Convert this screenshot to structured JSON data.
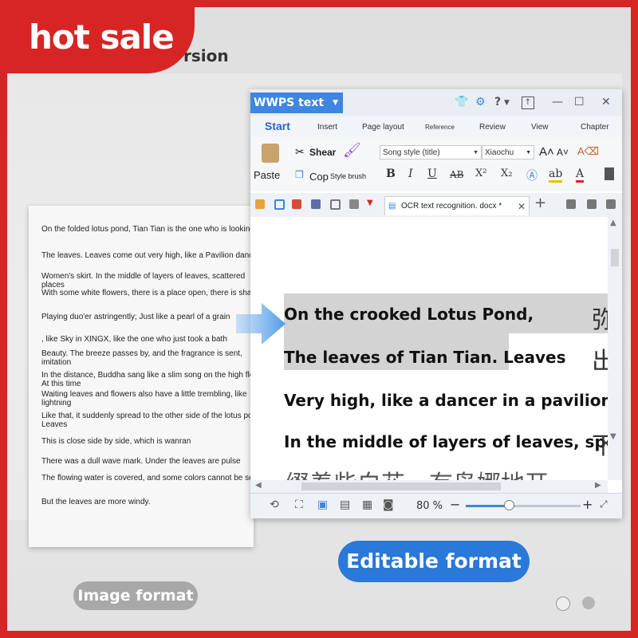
{
  "badge": {
    "text": "hot sale"
  },
  "top_title": "rsion",
  "left_paper": {
    "lines": [
      "On the folded lotus pond, Tian Tian is the one who is looking",
      "The leaves. Leaves come out very high, like a Pavilion dance",
      "Women's skirt. In the middle of layers of leaves, scattered places",
      "With some white flowers, there is a place open, there is shame",
      "Playing duo'er astringently; Just like a pearl of a grain",
      ", like Sky in XINGX, like the one who just took a bath",
      "Beauty. The breeze passes by, and the fragrance is sent, imitation",
      "In the distance, Buddha sang like a slim song on the high floor. At this time",
      "Waiting leaves and flowers also have a little trembling, like lightning",
      "Like that, it suddenly spread to the other side of the lotus pond. Leaves",
      "This is close side by side, which is wanran",
      "There was a dull wave mark. Under the leaves are pulse",
      "The flowing water is covered, and some colors cannot be seen;",
      "But the leaves are more windy."
    ]
  },
  "window": {
    "app_name": "WWPS text",
    "help": "?",
    "menu": {
      "start": "Start",
      "insert": "Insert",
      "page_layout": "Page layout",
      "reference": "Reference",
      "review": "Review",
      "view": "View",
      "chapter": "Chapter"
    },
    "ribbon": {
      "shear": "Shear",
      "paste": "Paste",
      "copy": "Cop",
      "style_brush": "Style brush",
      "font_style": "Song style (title)",
      "font_size": "Xiaochu"
    },
    "doc_tab": "OCR text recognition. docx *",
    "doc_lines": [
      "On the crooked Lotus Pond,",
      "The leaves of Tian Tian. Leaves",
      "Very high, like a dancer in a pavilion",
      "In the middle of layers of leaves, sporadic"
    ],
    "cjk": {
      "right1": "弥",
      "right2": "出",
      "right3": "下",
      "bottom": "缀着些白花，有袅娜地开"
    },
    "zoom": "80 %"
  },
  "labels": {
    "image_format": "Image format",
    "editable_format": "Editable format"
  },
  "colors": {
    "red": "#d62524",
    "blue": "#2a78d8",
    "gray_pill": "#a8a8a8"
  }
}
